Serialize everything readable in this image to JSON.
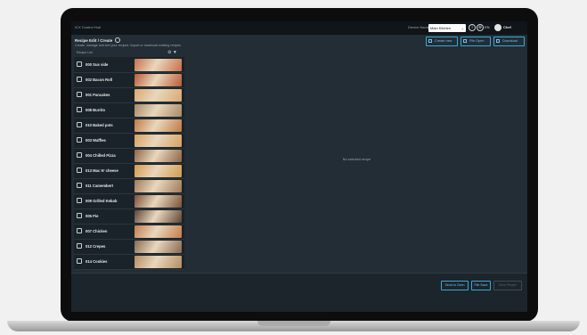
{
  "app": {
    "title": "ICX Control Hub",
    "device_label": "Device Name",
    "device_value": "Main Kitchen",
    "language": "EN",
    "user": "Chef"
  },
  "header": {
    "title": "Recipe Edit / Create",
    "subtitle": "Create, manage and sort your recipes. Import or download existing recipes.",
    "buttons": [
      "Create new",
      "File Open",
      "Download"
    ]
  },
  "list": {
    "label": "Recipe List",
    "recipes": [
      {
        "name": "000 Sus vide",
        "thumb": "#c8704a"
      },
      {
        "name": "002 Bacon Roll",
        "thumb": "#b95b36"
      },
      {
        "name": "001 Pancakes",
        "thumb": "#d9a970"
      },
      {
        "name": "008 Burrito",
        "thumb": "#a88a66"
      },
      {
        "name": "010 Baked pots",
        "thumb": "#c07a45"
      },
      {
        "name": "003 Waffles",
        "thumb": "#d7a25f"
      },
      {
        "name": "004 Chilled Pizza",
        "thumb": "#8e6446"
      },
      {
        "name": "013 Mac N' cheese",
        "thumb": "#d49a4b"
      },
      {
        "name": "011 Camembert",
        "thumb": "#a07a58"
      },
      {
        "name": "009 Grilled Kebab",
        "thumb": "#7c5138"
      },
      {
        "name": "005 Pie",
        "thumb": "#5e4535"
      },
      {
        "name": "007 Chicken",
        "thumb": "#c47d4d"
      },
      {
        "name": "012 Crepes",
        "thumb": "#8a6a52"
      },
      {
        "name": "014 Cookies",
        "thumb": "#b58c62"
      }
    ]
  },
  "main": {
    "empty_message": "No selected recipe"
  },
  "footer": {
    "buttons": [
      "Send to Oven",
      "File Save",
      "Save Recipe"
    ]
  },
  "colors": {
    "accent": "#39a9d7",
    "background": "#222d35",
    "topbar": "#0f1519"
  },
  "icons": [
    "info-icon",
    "globe-icon",
    "user-icon",
    "folder-icon",
    "file-icon",
    "download-icon",
    "settings-icon",
    "filter-icon",
    "checkbox-icon"
  ]
}
